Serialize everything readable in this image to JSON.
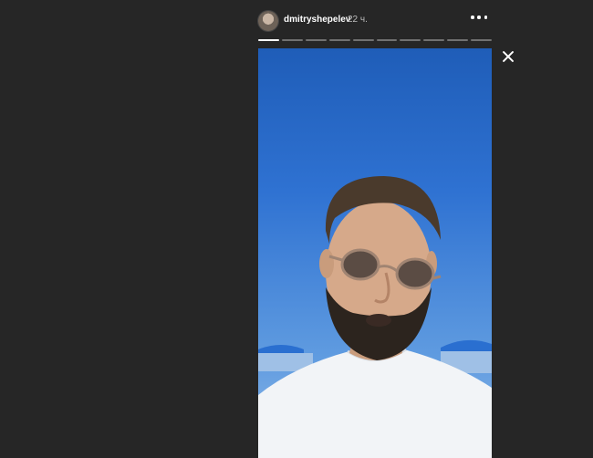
{
  "story": {
    "username": "dmitryshepelev",
    "time_ago": "22 ч.",
    "segments_total": 10,
    "active_segment": 1
  },
  "icons": {
    "avatar": "profile-avatar",
    "more": "more-options-icon",
    "close": "close-icon"
  },
  "colors": {
    "background": "#262626",
    "sky": "#2f72d2",
    "text": "#ffffff"
  }
}
